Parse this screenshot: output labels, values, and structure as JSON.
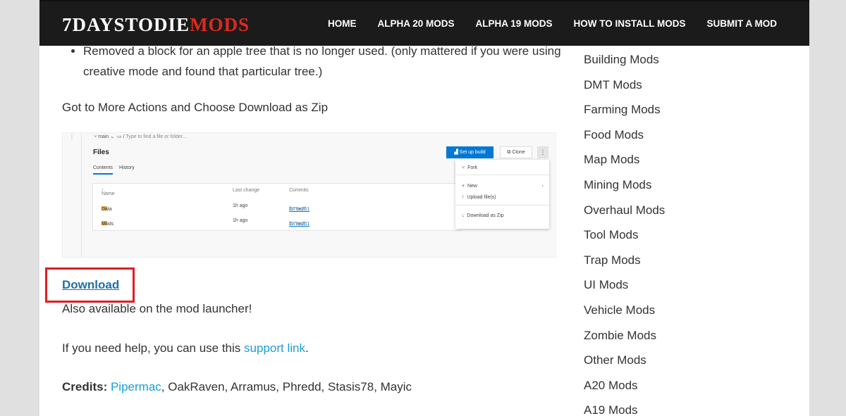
{
  "header": {
    "logo_main": "7DAYSTODIE",
    "logo_accent": "MODS",
    "nav": [
      {
        "label": "HOME"
      },
      {
        "label": "ALPHA 20 MODS"
      },
      {
        "label": "ALPHA 19 MODS"
      },
      {
        "label": "HOW TO INSTALL MODS"
      },
      {
        "label": "SUBMIT A MOD"
      }
    ]
  },
  "content": {
    "bullet_text": "Removed a block for an apple tree that is no longer used. (only mattered if you were using creative mode and found that particular tree.)",
    "more_actions": "Got to More Actions and Choose Download as Zip",
    "download_label": "Download",
    "launcher_text": "Also available on the mod launcher!",
    "help_text": "If you need help, you can use this",
    "help_link": "support link",
    "help_end": ".",
    "credits_label": "Credits:",
    "credits_link": "Pipermac",
    "credits_rest": ", OakRaven, Arramus, Phredd, Stasis78, Mayic"
  },
  "screenshot": {
    "branch": "main",
    "path_placeholder": "Type to find a file or folder...",
    "files_title": "Files",
    "tab_contents": "Contents",
    "tab_history": "History",
    "col_name": "Name",
    "col_last_change": "Last change",
    "col_commits": "Commits",
    "rows": [
      {
        "name": "Data",
        "last_change": "1h ago",
        "commit": "fb75e251",
        "author": "27 Rod"
      },
      {
        "name": "Mods",
        "last_change": "1h ago",
        "commit": "fb75e251",
        "author": "27 Rod"
      }
    ],
    "btn_build": "Set up build",
    "btn_clone": "Clone",
    "menu_fork": "Fork",
    "menu_new": "New",
    "menu_upload": "Upload file(s)",
    "menu_download_zip": "Download as Zip"
  },
  "sidebar": {
    "items": [
      {
        "label": "Building Mods"
      },
      {
        "label": "DMT Mods"
      },
      {
        "label": "Farming Mods"
      },
      {
        "label": "Food Mods"
      },
      {
        "label": "Map Mods"
      },
      {
        "label": "Mining Mods"
      },
      {
        "label": "Overhaul Mods"
      },
      {
        "label": "Tool Mods"
      },
      {
        "label": "Trap Mods"
      },
      {
        "label": "UI Mods"
      },
      {
        "label": "Vehicle Mods"
      },
      {
        "label": "Zombie Mods"
      },
      {
        "label": "Other Mods"
      },
      {
        "label": "A20 Mods"
      },
      {
        "label": "A19 Mods"
      }
    ]
  },
  "colors": {
    "header_bg": "#1b1b1b",
    "logo_accent": "#e0281f",
    "link": "#1aa0d8",
    "highlight_box": "#e31b23"
  }
}
